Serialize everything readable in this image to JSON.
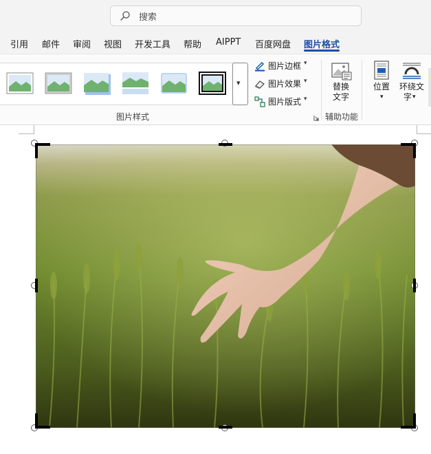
{
  "search": {
    "placeholder": "搜索"
  },
  "tabs": [
    {
      "label": "引用",
      "active": false
    },
    {
      "label": "邮件",
      "active": false
    },
    {
      "label": "审阅",
      "active": false
    },
    {
      "label": "视图",
      "active": false
    },
    {
      "label": "开发工具",
      "active": false
    },
    {
      "label": "帮助",
      "active": false
    },
    {
      "label": "AIPPT",
      "active": false
    },
    {
      "label": "百度网盘",
      "active": false
    },
    {
      "label": "图片格式",
      "active": true
    }
  ],
  "ribbon": {
    "picture_styles": {
      "group_label": "图片样式",
      "commands": [
        {
          "label": "图片边框"
        },
        {
          "label": "图片效果"
        },
        {
          "label": "图片版式"
        }
      ]
    },
    "accessibility": {
      "group_label": "辅助功能",
      "alt_text_line1": "替换",
      "alt_text_line2": "文字"
    },
    "arrange": {
      "position_label": "位置",
      "wrap_line1": "环绕文",
      "wrap_line2": "字"
    }
  },
  "colors": {
    "accent": "#1a4fa0",
    "ribbon_bg": "#fbfbfb",
    "titlebar_bg": "#f3f3f3"
  }
}
